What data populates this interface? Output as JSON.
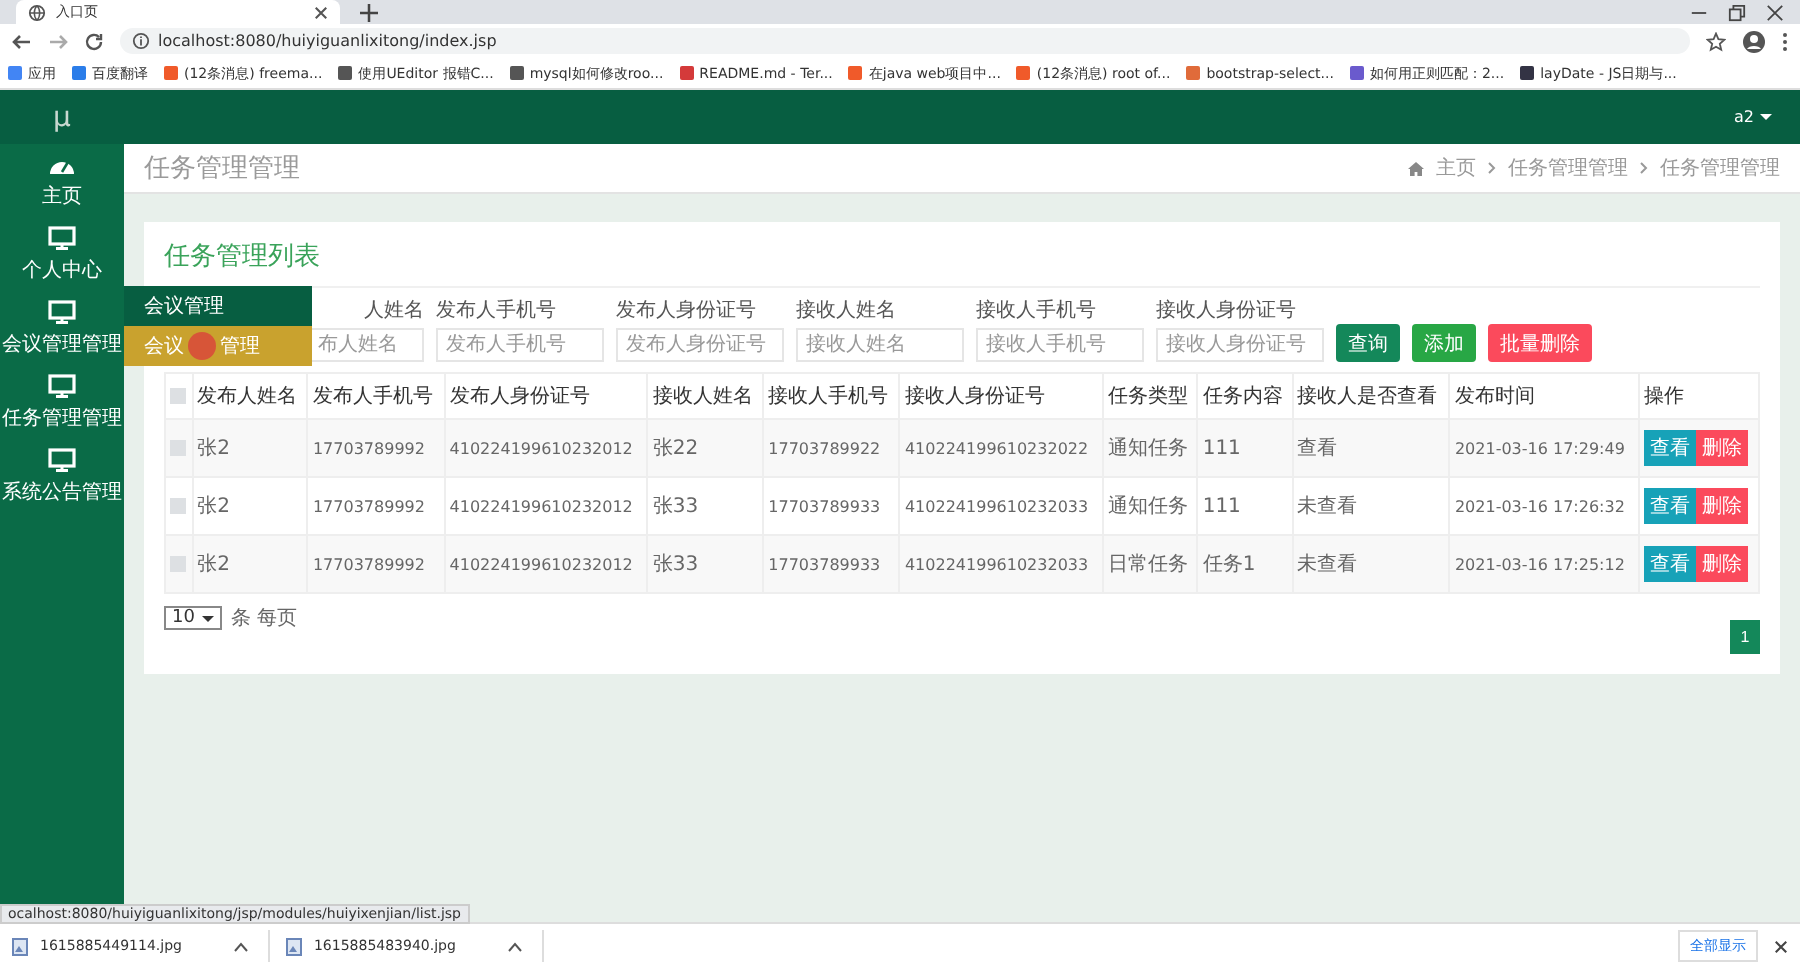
{
  "browser": {
    "tab_title": "入口页",
    "url": "localhost:8080/huiyiguanlixitong/index.jsp",
    "bookmarks": [
      {
        "label": "应用",
        "color": "#4285f4"
      },
      {
        "label": "百度翻译",
        "color": "#2b7de9"
      },
      {
        "label": "(12条消息) freema...",
        "color": "#f05a2a"
      },
      {
        "label": "使用UEditor 报错C...",
        "color": "#555555"
      },
      {
        "label": "mysql如何修改roo...",
        "color": "#555555"
      },
      {
        "label": "README.md - Ter...",
        "color": "#d43a3a"
      },
      {
        "label": "在java web项目中...",
        "color": "#f05a2a"
      },
      {
        "label": "(12条消息) root of...",
        "color": "#f05a2a"
      },
      {
        "label": "bootstrap-select...",
        "color": "#e06b3a"
      },
      {
        "label": "如何用正则匹配：2...",
        "color": "#6a5acd"
      },
      {
        "label": "layDate - JS日期与...",
        "color": "#333344"
      }
    ]
  },
  "app": {
    "logo": "μ",
    "user": "a2",
    "sidebar": [
      {
        "label": "主页",
        "kind": "dashboard"
      },
      {
        "label": "个人中心",
        "kind": "monitor"
      },
      {
        "label": "会议管理管理",
        "kind": "monitor"
      },
      {
        "label": "任务管理管理",
        "kind": "monitor"
      },
      {
        "label": "系统公告管理",
        "kind": "monitor"
      }
    ],
    "submenu": [
      {
        "label_parts": [
          "会议管理"
        ],
        "selected": false
      },
      {
        "label_parts": [
          "会议",
          "管理"
        ],
        "selected": true
      }
    ],
    "page_title": "任务管理管理",
    "breadcrumb": [
      "主页",
      "任务管理管理",
      "任务管理管理"
    ],
    "card_title": "任务管理列表",
    "filters": [
      {
        "label": "人姓名",
        "placeholder": "布人姓名"
      },
      {
        "label": "发布人手机号",
        "placeholder": "发布人手机号"
      },
      {
        "label": "发布人身份证号",
        "placeholder": "发布人身份证号"
      },
      {
        "label": "接收人姓名",
        "placeholder": "接收人姓名"
      },
      {
        "label": "接收人手机号",
        "placeholder": "接收人手机号"
      },
      {
        "label": "接收人身份证号",
        "placeholder": "接收人身份证号"
      }
    ],
    "buttons": [
      {
        "label": "查询",
        "kind": "search"
      },
      {
        "label": "添加",
        "kind": "add"
      },
      {
        "label": "批量删除",
        "kind": "delete"
      }
    ],
    "all_checked": false,
    "columns": [
      "发布人姓名",
      "发布人手机号",
      "发布人身份证号",
      "接收人姓名",
      "接收人手机号",
      "接收人身份证号",
      "任务类型",
      "任务内容",
      "接收人是否查看",
      "发布时间",
      "操作"
    ],
    "rows": [
      {
        "checked": false,
        "cells": [
          "张2",
          "17703789992",
          "410224199610232012",
          "张22",
          "17703789922",
          "410224199610232022",
          "通知任务",
          "111",
          "查看",
          "2021-03-16 17:29:49"
        ],
        "actions": [
          "查看",
          "删除"
        ]
      },
      {
        "checked": false,
        "cells": [
          "张2",
          "17703789992",
          "410224199610232012",
          "张33",
          "17703789933",
          "410224199610232033",
          "通知任务",
          "111",
          "未查看",
          "2021-03-16 17:26:32"
        ],
        "actions": [
          "查看",
          "删除"
        ]
      },
      {
        "checked": false,
        "cells": [
          "张2",
          "17703789992",
          "410224199610232012",
          "张33",
          "17703789933",
          "410224199610232033",
          "日常任务",
          "任务1",
          "未查看",
          "2021-03-16 17:25:12"
        ],
        "actions": [
          "查看",
          "删除"
        ]
      }
    ],
    "page_size": "10",
    "page_size_suffix": "条 每页",
    "pages": [
      {
        "label": "1",
        "selected": true
      }
    ]
  },
  "status_url": "ocalhost:8080/huiyiguanlixitong/jsp/modules/huiyixenjian/list.jsp",
  "downloads": [
    {
      "name": "1615885449114.jpg"
    },
    {
      "name": "1615885483940.jpg"
    }
  ],
  "show_all": "全部显示"
}
